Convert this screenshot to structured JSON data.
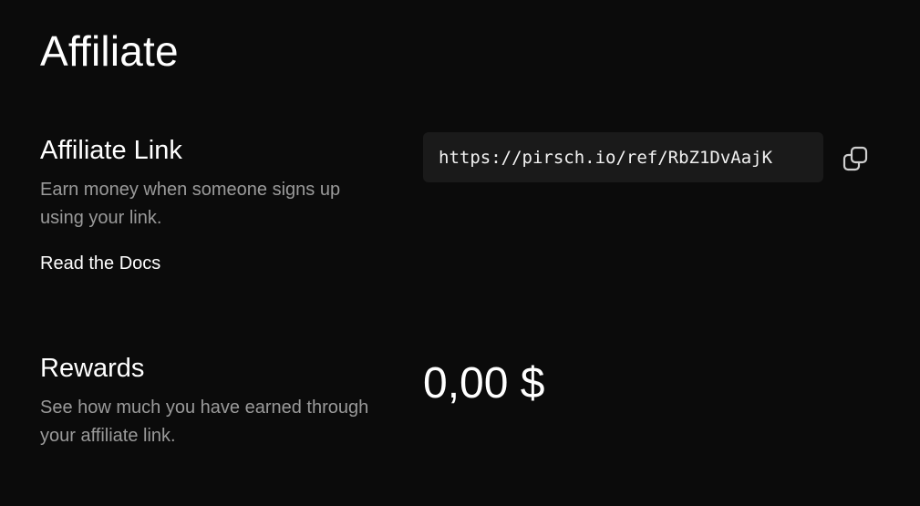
{
  "page": {
    "title": "Affiliate"
  },
  "affiliate_link": {
    "title": "Affiliate Link",
    "description": "Earn money when someone signs up using your link.",
    "docs_label": "Read the Docs",
    "url": "https://pirsch.io/ref/RbZ1DvAajK",
    "copy_icon": "copy-icon"
  },
  "rewards": {
    "title": "Rewards",
    "description": "See how much you have earned through your affiliate link.",
    "amount": "0,00 $"
  },
  "colors": {
    "background": "#0b0b0b",
    "text_primary": "#ffffff",
    "text_secondary": "#9a9a9a",
    "input_background": "#1a1a1a"
  }
}
